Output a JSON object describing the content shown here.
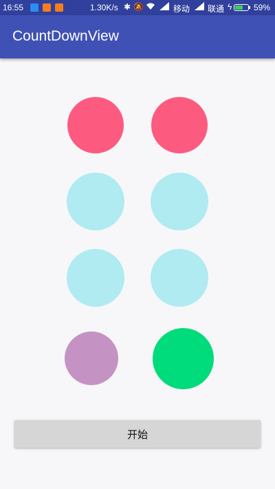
{
  "status_bar": {
    "time": "16:55",
    "speed": "1.30K/s",
    "carrier1": "移动",
    "carrier2": "联通",
    "battery_pct": "59%",
    "battery_level": 0.59,
    "icons": [
      "notification-icon",
      "shop-icon",
      "video-icon",
      "bluetooth-icon",
      "mute-icon",
      "wifi-icon",
      "signal-icon",
      "signal-icon",
      "charging-icon",
      "battery-icon"
    ]
  },
  "app_bar": {
    "title": "CountDownView"
  },
  "circles": {
    "colors": {
      "pink": "#fd5a7f",
      "light_cyan": "#afebf1",
      "purple": "#c493c3",
      "green": "#00db7b"
    }
  },
  "start_button": {
    "label": "开始"
  }
}
